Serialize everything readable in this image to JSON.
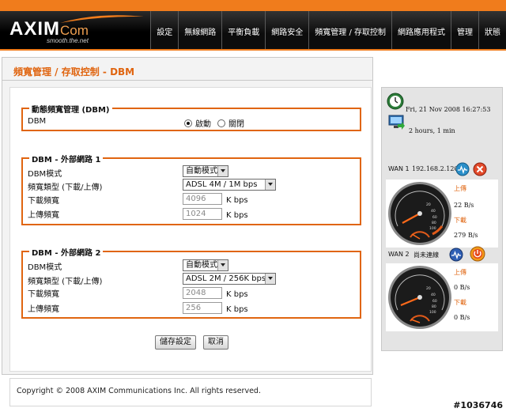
{
  "header": {
    "logo_main": "AXIM",
    "logo_com": "Com",
    "logo_tagline": "smooth.the.net",
    "nav": [
      "設定",
      "無線網路",
      "平衡負載",
      "網路安全",
      "頻寬管理 / 存取控制",
      "網路應用程式",
      "管理",
      "狀態"
    ]
  },
  "page": {
    "title": "頻寬管理 / 存取控制 - DBM"
  },
  "dbm_section": {
    "title": "動態頻寬管理 (DBM)",
    "label": "DBM",
    "options": [
      "啟動",
      "關閉"
    ],
    "selected": "啟動"
  },
  "wan1": {
    "title": "DBM - 外部網路 1",
    "mode_label": "DBM模式",
    "mode_value": "自動模式",
    "type_label": "頻寬類型 (下載/上傳)",
    "type_value": "ADSL 4M / 1M bps",
    "down_label": "下載頻寬",
    "down_value": "4096",
    "up_label": "上傳頻寬",
    "up_value": "1024",
    "unit": "K bps"
  },
  "wan2": {
    "title": "DBM - 外部網路 2",
    "mode_label": "DBM模式",
    "mode_value": "自動模式",
    "type_label": "頻寬類型 (下載/上傳)",
    "type_value": "ADSL 2M / 256K bps",
    "down_label": "下載頻寬",
    "down_value": "2048",
    "up_label": "上傳頻寬",
    "up_value": "256",
    "unit": "K bps"
  },
  "buttons": {
    "save": "儲存設定",
    "cancel": "取消"
  },
  "footer": {
    "copyright": "Copyright © 2008 AXIM Communications Inc. All rights reserved."
  },
  "status": {
    "datetime": "Fri, 21 Nov 2008 16:27:53",
    "uptime": "2 hours, 1 min",
    "wan1_label": "WAN 1",
    "wan1_ip": "192.168.2.120",
    "wan1_up_label": "上傳",
    "wan1_up_value": "22 B/s",
    "wan1_down_label": "下載",
    "wan1_down_value": "279 B/s",
    "wan2_label": "WAN 2",
    "wan2_ip": "尚未連線",
    "wan2_up_label": "上傳",
    "wan2_up_value": "0 B/s",
    "wan2_down_label": "下載",
    "wan2_down_value": "0 B/s",
    "gauge_ticks": [
      "20",
      "40",
      "60",
      "80",
      "100"
    ]
  },
  "watermark": "#1036746",
  "colors": {
    "accent": "#e06510",
    "header_bg": "#000000"
  }
}
